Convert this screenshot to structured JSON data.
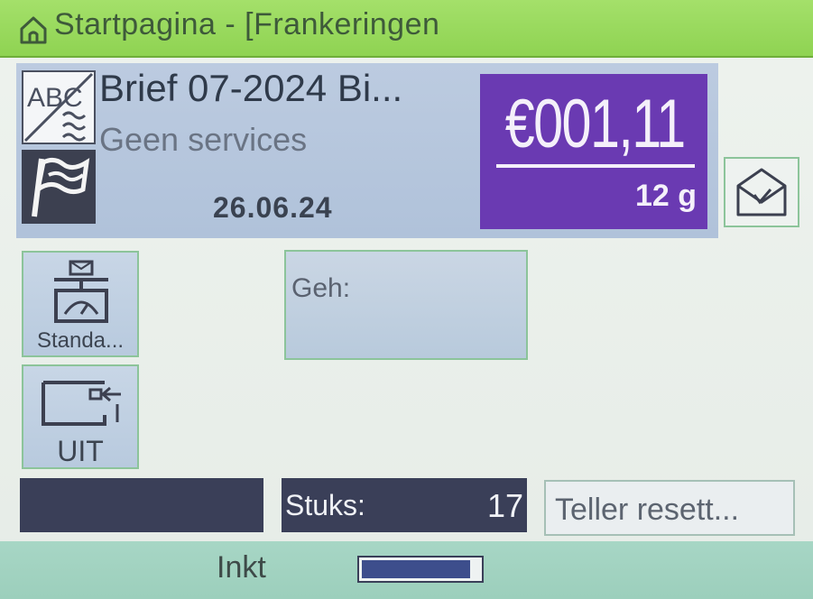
{
  "titlebar": {
    "title": "Startpagina - [Frankeringen",
    "icon": "home-icon"
  },
  "product": {
    "name": "Brief 07-2024 Bi...",
    "services": "Geen services",
    "date": "26.06.24",
    "type_icon": "abc-document-icon",
    "mode_icon": "flag-icon"
  },
  "postage": {
    "amount": "€001,11",
    "weight": "12 g",
    "background_color": "#6a3ab2"
  },
  "envelope_button": {
    "icon": "envelope-icon"
  },
  "buttons": {
    "scale_label": "Standa...",
    "scale_icon": "scale-icon",
    "uit_label": "UIT",
    "uit_icon": "envelope-feed-icon"
  },
  "geh": {
    "label": "Geh:"
  },
  "counter": {
    "label": "Stuks:",
    "value": "17",
    "reset_label": "Teller resett..."
  },
  "ink": {
    "label": "Inkt",
    "level_percent": 95
  }
}
